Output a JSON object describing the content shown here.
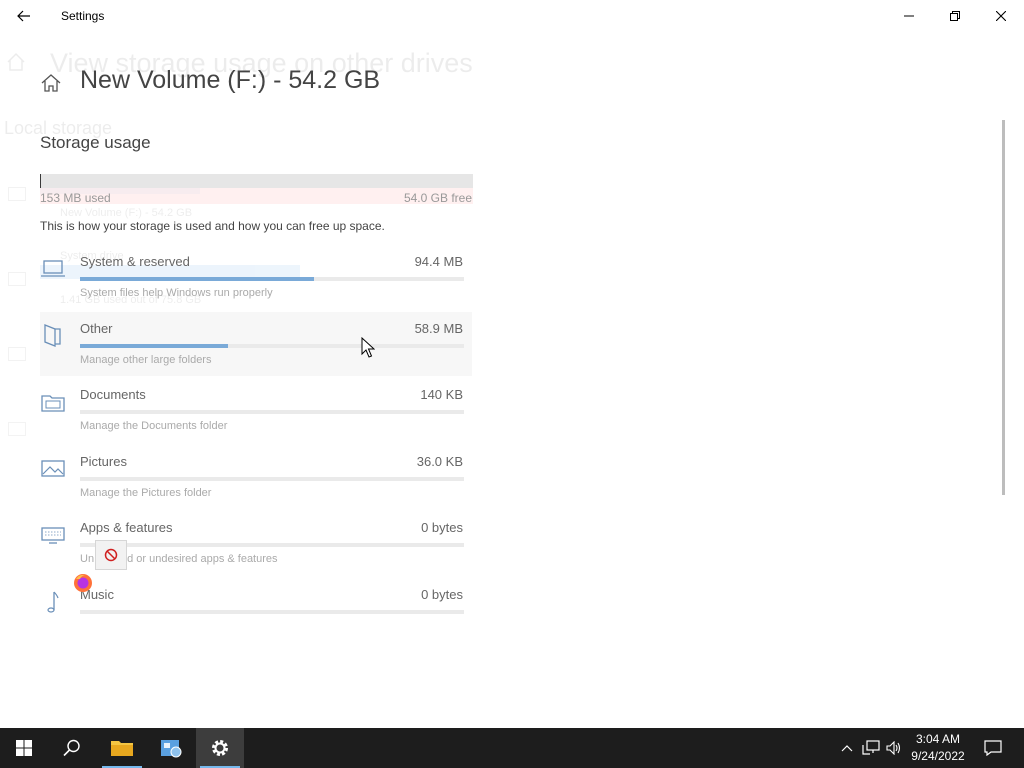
{
  "window": {
    "title": "Settings"
  },
  "ghost": {
    "title": "View storage usage on other drives",
    "subtitle": "Local storage",
    "items": [
      "New Volume (F:) - 54.2 GB",
      "System drive",
      "1.41 GB used out of 75.8 GB"
    ]
  },
  "page": {
    "title": "New Volume (F:) - 54.2 GB",
    "section_title": "Storage usage",
    "used_text": "153 MB used",
    "free_text": "54.0 GB free",
    "used_fraction": 0.003,
    "description": "This is how your storage is used and how you can free up space."
  },
  "categories": [
    {
      "label": "System & reserved",
      "size": "94.4 MB",
      "sub": "System files help Windows run properly",
      "fill": 0.61,
      "icon": "laptop-icon"
    },
    {
      "label": "Other",
      "size": "58.9 MB",
      "sub": "Manage other large folders",
      "fill": 0.385,
      "icon": "folder-other-icon"
    },
    {
      "label": "Documents",
      "size": "140 KB",
      "sub": "Manage the Documents folder",
      "fill": 0.0,
      "icon": "documents-icon"
    },
    {
      "label": "Pictures",
      "size": "36.0 KB",
      "sub": "Manage the Pictures folder",
      "fill": 0.0,
      "icon": "pictures-icon"
    },
    {
      "label": "Apps & features",
      "size": "0 bytes",
      "sub": "Un    unused or undesired apps & features",
      "fill": 0.0,
      "icon": "apps-icon"
    },
    {
      "label": "Music",
      "size": "0 bytes",
      "sub": "",
      "fill": 0.0,
      "icon": "music-icon"
    }
  ],
  "taskbar": {
    "time": "3:04 AM",
    "date": "9/24/2022"
  },
  "colors": {
    "accent": "#0078d7",
    "bar_fill": "#7aaad8",
    "taskbar": "#1d1d1d"
  }
}
